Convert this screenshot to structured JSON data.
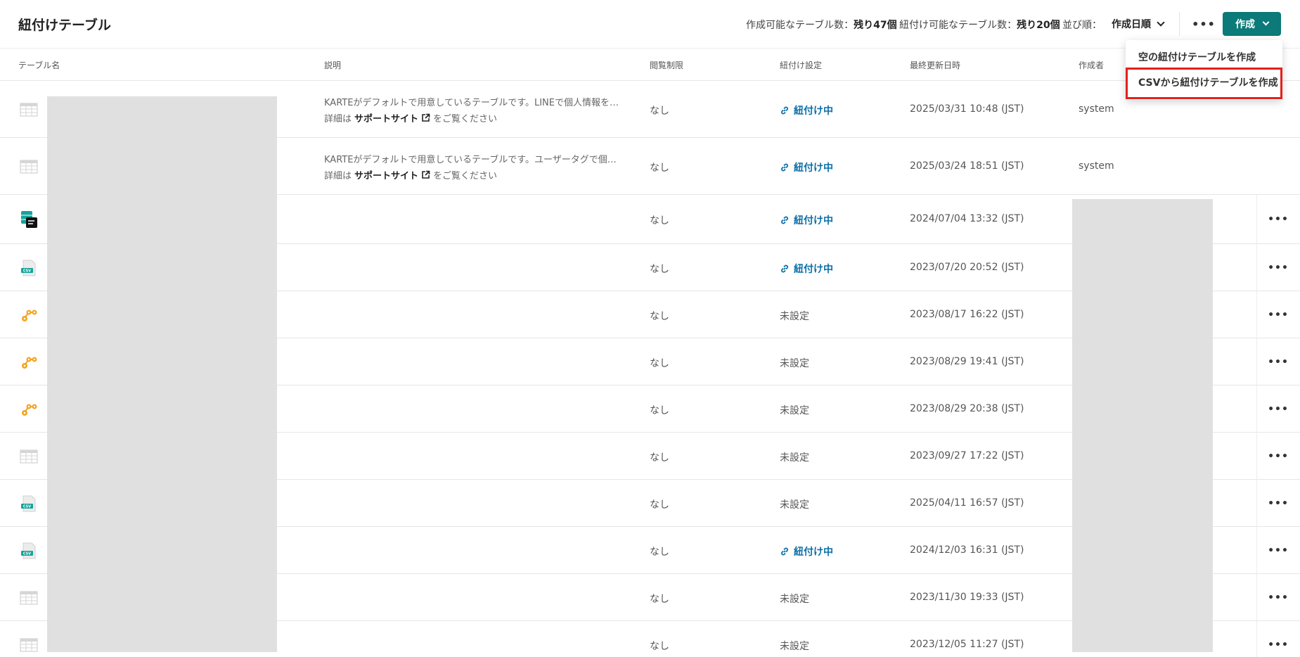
{
  "header": {
    "title": "紐付けテーブル",
    "stats": [
      {
        "label": "作成可能なテーブル数：",
        "value": "残り47個"
      },
      {
        "label": "紐付け可能なテーブル数：",
        "value": "残り20個"
      }
    ],
    "sort_label": "並び順：",
    "sort_value": "作成日順",
    "more_label": "•••",
    "create_label": "作成"
  },
  "dropdown": {
    "items": [
      "空の紐付けテーブルを作成",
      "CSVから紐付けテーブルを作成"
    ],
    "highlighted_index": 1
  },
  "columns": [
    "テーブル名",
    "説明",
    "閲覧制限",
    "紐付け設定",
    "最終更新日時",
    "作成者"
  ],
  "rows": [
    {
      "icon": "table-grid-icon",
      "desc": "KARTEがデフォルトで用意しているテーブルです。LINEで個人情報を…",
      "desc2_prefix": "詳細は",
      "desc2_link": "サポートサイト",
      "desc2_suffix": "をご覧ください",
      "restriction": "なし",
      "status": "紐付け中",
      "linked": true,
      "updated": "2025/03/31 10:48 (JST)",
      "author": "system",
      "more": false
    },
    {
      "icon": "table-grid-icon",
      "desc": "KARTEがデフォルトで用意しているテーブルです。ユーザータグで個…",
      "desc2_prefix": "詳細は",
      "desc2_link": "サポートサイト",
      "desc2_suffix": "をご覧ください",
      "restriction": "なし",
      "status": "紐付け中",
      "linked": true,
      "updated": "2025/03/24 18:51 (JST)",
      "author": "system",
      "more": false
    },
    {
      "icon": "sql-table-icon",
      "desc": "",
      "restriction": "なし",
      "status": "紐付け中",
      "linked": true,
      "updated": "2024/07/04 13:32 (JST)",
      "author": "",
      "more": true
    },
    {
      "icon": "csv-file-icon",
      "desc": "",
      "restriction": "なし",
      "status": "紐付け中",
      "linked": true,
      "updated": "2023/07/20 20:52 (JST)",
      "author": "",
      "more": true
    },
    {
      "icon": "workflow-icon",
      "desc": "",
      "restriction": "なし",
      "status": "未設定",
      "linked": false,
      "updated": "2023/08/17 16:22 (JST)",
      "author": "",
      "more": true
    },
    {
      "icon": "workflow-icon",
      "desc": "",
      "restriction": "なし",
      "status": "未設定",
      "linked": false,
      "updated": "2023/08/29 19:41 (JST)",
      "author": "",
      "more": true
    },
    {
      "icon": "workflow-icon",
      "desc": "",
      "restriction": "なし",
      "status": "未設定",
      "linked": false,
      "updated": "2023/08/29 20:38 (JST)",
      "author": "",
      "more": true
    },
    {
      "icon": "table-grid-icon",
      "desc": "",
      "restriction": "なし",
      "status": "未設定",
      "linked": false,
      "updated": "2023/09/27 17:22 (JST)",
      "author": "",
      "more": true
    },
    {
      "icon": "csv-file-icon",
      "desc": "",
      "restriction": "なし",
      "status": "未設定",
      "linked": false,
      "updated": "2025/04/11 16:57 (JST)",
      "author": "",
      "more": true
    },
    {
      "icon": "csv-file-icon",
      "desc": "",
      "restriction": "なし",
      "status": "紐付け中",
      "linked": true,
      "updated": "2024/12/03 16:31 (JST)",
      "author": "",
      "more": true
    },
    {
      "icon": "table-grid-icon",
      "desc": "",
      "restriction": "なし",
      "status": "未設定",
      "linked": false,
      "updated": "2023/11/30 19:33 (JST)",
      "author": "",
      "more": true
    },
    {
      "icon": "table-grid-icon",
      "desc": "",
      "restriction": "なし",
      "status": "未設定",
      "linked": false,
      "updated": "2023/12/05 11:27 (JST)",
      "author": "",
      "more": true
    }
  ],
  "colors": {
    "accent": "#0b7a78",
    "link": "#0b6fa8",
    "highlight": "#e2211c"
  }
}
